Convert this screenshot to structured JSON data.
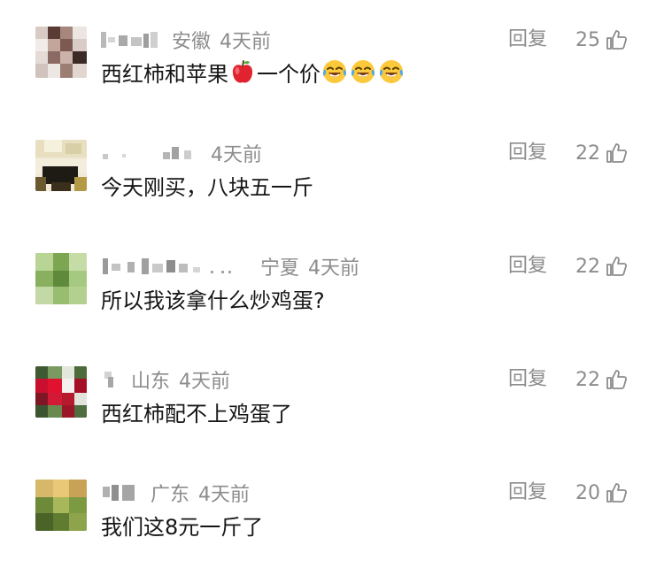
{
  "comments": [
    {
      "location": "安徽",
      "time": "4天前",
      "content_parts": [
        "西红柿和苹果",
        "一个价"
      ],
      "content_emojis": [
        "apple-emoji",
        "laughing-crying-emoji",
        "laughing-crying-emoji",
        "laughing-crying-emoji"
      ],
      "reply_label": "回复",
      "likes": "25"
    },
    {
      "location": "",
      "time": "4天前",
      "content": "今天刚买，八块五一斤",
      "reply_label": "回复",
      "likes": "22"
    },
    {
      "location": "宁夏",
      "time": "4天前",
      "content": "所以我该拿什么炒鸡蛋?",
      "reply_label": "回复",
      "likes": "22"
    },
    {
      "location": "山东",
      "time": "4天前",
      "content": "西红柿配不上鸡蛋了",
      "reply_label": "回复",
      "likes": "22"
    },
    {
      "location": "广东",
      "time": "4天前",
      "content": "我们这8元一斤了",
      "reply_label": "回复",
      "likes": "20"
    }
  ],
  "icons": {
    "like": "thumbs-up-outline-icon"
  },
  "colors": {
    "meta_text": "#8c8c8c",
    "content_text": "#161616",
    "background": "#ffffff"
  }
}
